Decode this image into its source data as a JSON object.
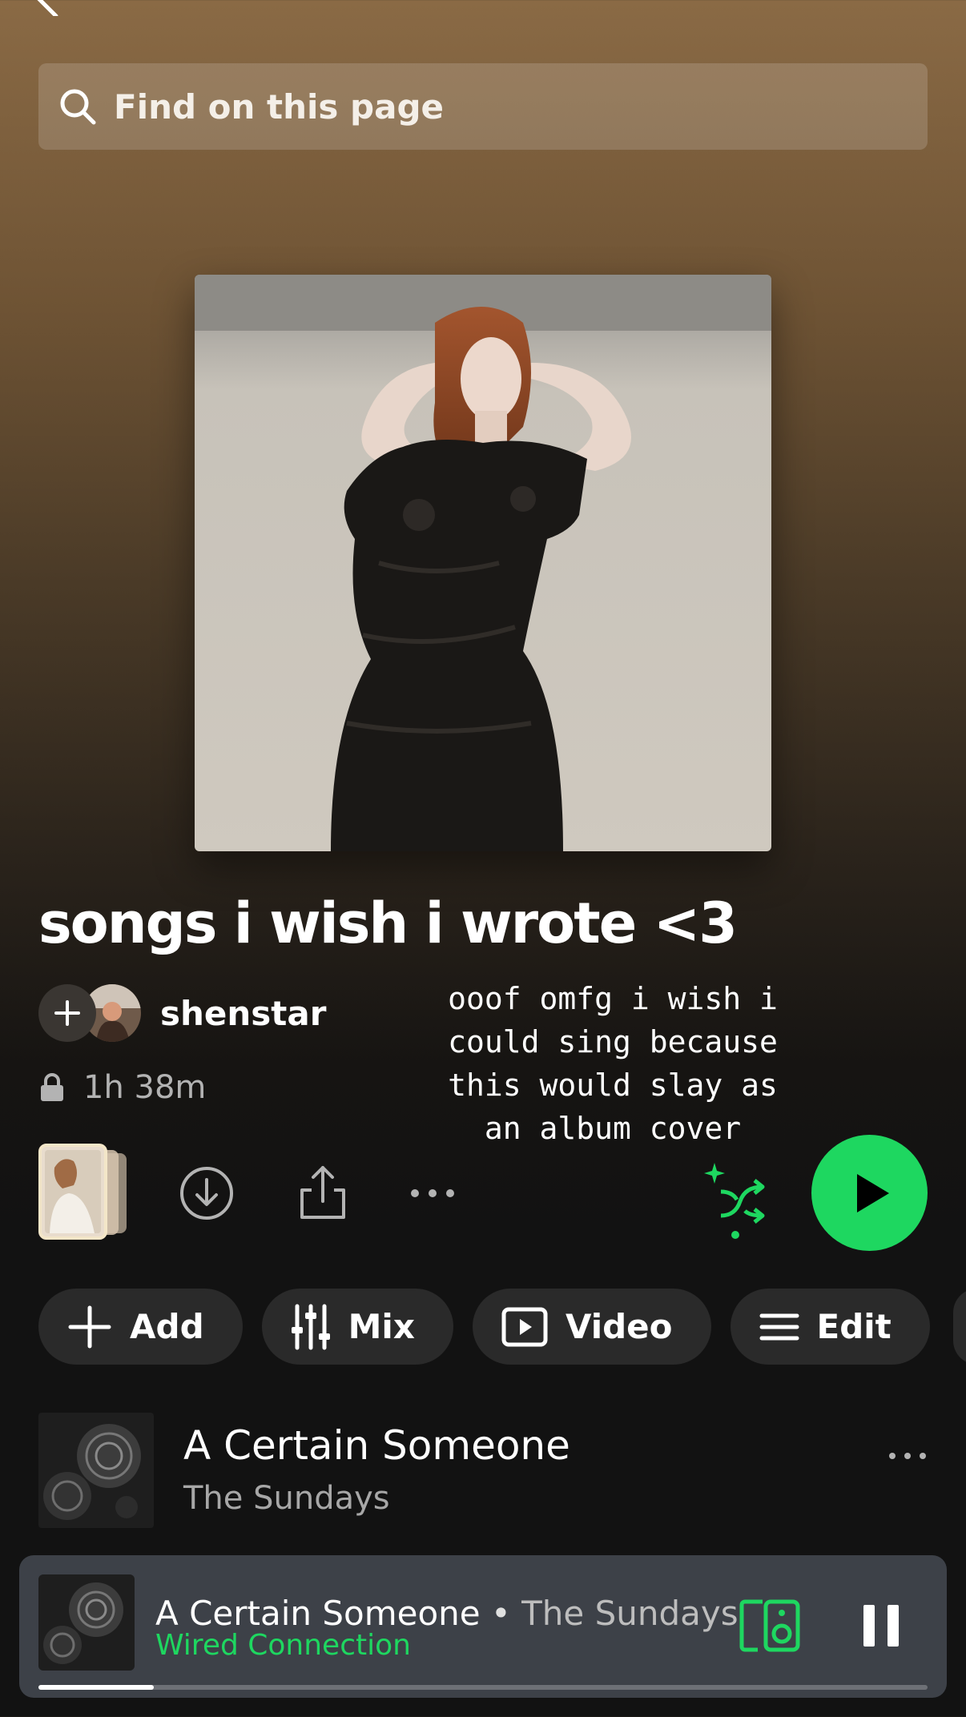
{
  "search": {
    "placeholder": "Find on this page"
  },
  "playlist": {
    "title": "songs i wish i wrote <3",
    "owner": "shenstar",
    "duration": "1h 38m",
    "caption": "ooof omfg i wish i\ncould sing because\nthis would slay as\nan album cover"
  },
  "chips": [
    {
      "label": "Add",
      "icon": "plus-icon"
    },
    {
      "label": "Mix",
      "icon": "sliders-icon"
    },
    {
      "label": "Video",
      "icon": "video-icon"
    },
    {
      "label": "Edit",
      "icon": "menu-lines-icon"
    }
  ],
  "tracks": [
    {
      "title": "A Certain Someone",
      "artist": "The Sundays"
    }
  ],
  "now_playing": {
    "title": "A Certain Someone",
    "separator": " • ",
    "artist": "The Sundays",
    "device": "Wired Connection",
    "progress": 0.13
  },
  "colors": {
    "accent": "#1ed760",
    "background": "#121212",
    "header_tint": "#8a6a45"
  },
  "icons": [
    "back-arrow-icon",
    "search-icon",
    "plus-icon",
    "lock-icon",
    "download-icon",
    "share-icon",
    "more-icon",
    "smart-shuffle-icon",
    "play-icon",
    "connect-device-icon",
    "pause-icon"
  ]
}
